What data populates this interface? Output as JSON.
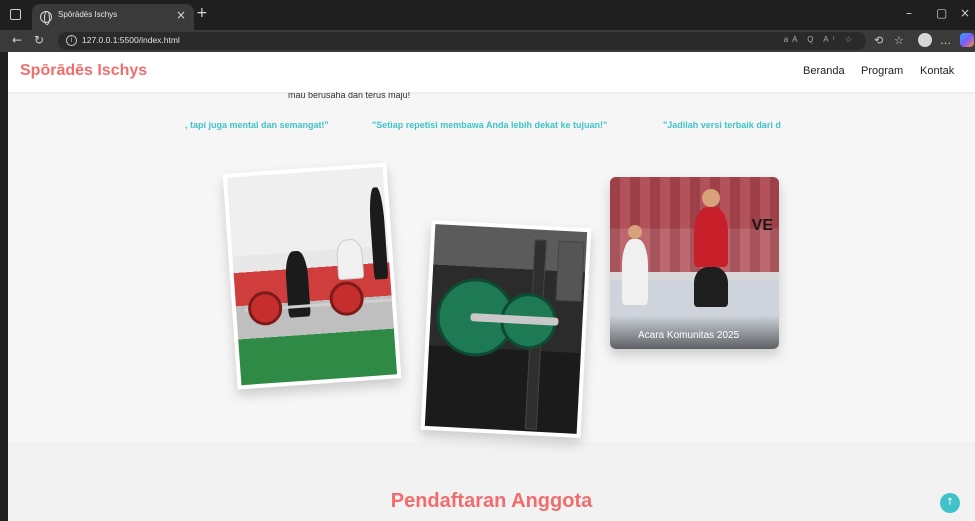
{
  "browser": {
    "tab_title": "Spōrādēs Ischys",
    "url": "127.0.0.1:5500/index.html",
    "url_icons": "aA Q A⁾ ☆"
  },
  "site": {
    "logo": "Spōrādēs Ischys",
    "nav": [
      "Beranda",
      "Program",
      "Kontak"
    ]
  },
  "hero": {
    "motto": "mau berusaha dan terus maju!",
    "quotes": [
      ", tapi juga mental dan semangat!\"",
      "\"Setiap repetisi membawa Anda lebih dekat ke tujuan!\"",
      "\"Jadilah versi terbaik dari d"
    ]
  },
  "gallery": {
    "card3_caption": "Acara Komunitas 2025",
    "card3_brand": "VE"
  },
  "section": {
    "title": "Pendaftaran Anggota"
  },
  "scroll_top_icon": "↑"
}
